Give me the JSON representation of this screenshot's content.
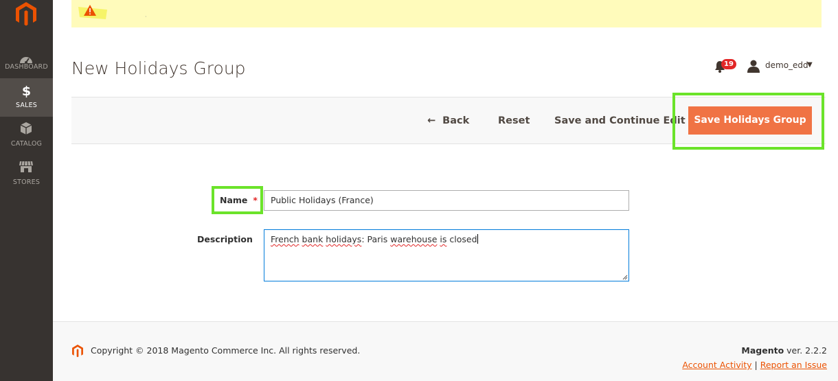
{
  "sidebar": {
    "items": [
      {
        "label": "DASHBOARD",
        "icon": "dashboard-icon"
      },
      {
        "label": "SALES",
        "icon": "dollar-icon",
        "active": true
      },
      {
        "label": "CATALOG",
        "icon": "box-icon"
      },
      {
        "label": "STORES",
        "icon": "store-icon"
      }
    ]
  },
  "header": {
    "title": "New Holidays Group",
    "notifications_count": "19",
    "user_name": "demo_edd"
  },
  "actions": {
    "back_label": "Back",
    "reset_label": "Reset",
    "save_continue_label": "Save and Continue Edit",
    "save_label": "Save Holidays Group"
  },
  "form": {
    "name_label": "Name",
    "name_required_mark": "*",
    "name_value": "Public Holidays (France)",
    "description_label": "Description",
    "description_parts": [
      "French",
      "bank",
      "holidays",
      ": Paris",
      "warehouse",
      "is",
      "closed"
    ]
  },
  "footer": {
    "copyright": "Copyright © 2018 Magento Commerce Inc. All rights reserved.",
    "brand": "Magento",
    "version": "ver. 2.2.2",
    "link_account_activity": "Account Activity",
    "separator": "|",
    "link_report_issue": "Report an Issue"
  },
  "colors": {
    "accent": "#eb5202",
    "highlight": "#6be32a",
    "sidebar_bg": "#373330",
    "notice_bg": "#fffbbb"
  }
}
